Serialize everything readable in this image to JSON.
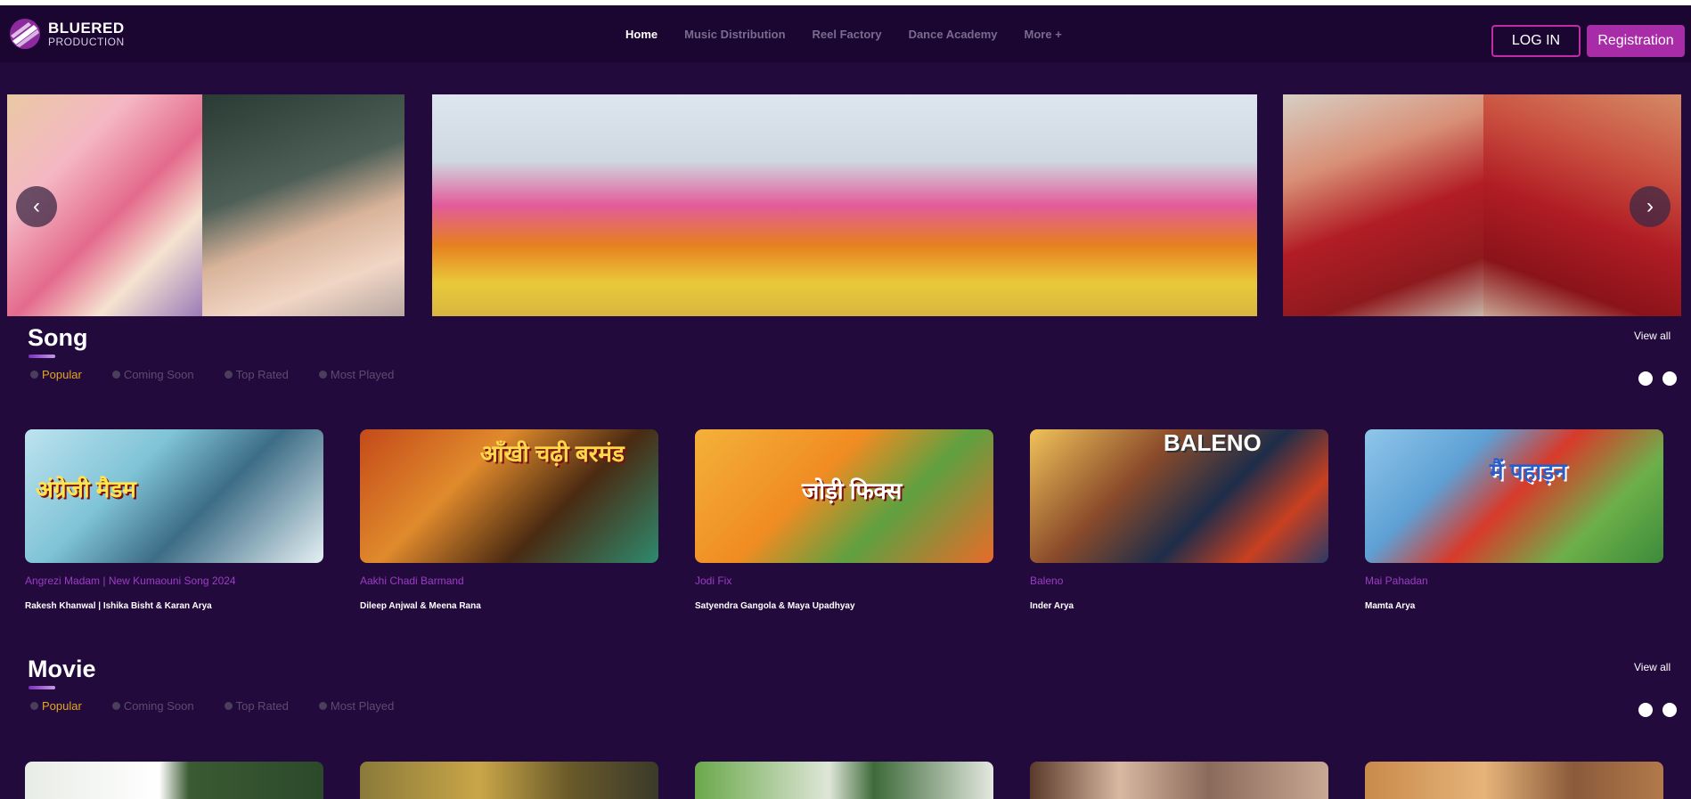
{
  "brand": {
    "line1": "BLUERED",
    "line2": "PRODUCTION",
    "accent": "#a82ba8"
  },
  "nav": {
    "items": [
      {
        "label": "Home",
        "active": true
      },
      {
        "label": "Music Distribution",
        "active": false
      },
      {
        "label": "Reel Factory",
        "active": false
      },
      {
        "label": "Dance Academy",
        "active": false
      },
      {
        "label": "More +",
        "active": false
      }
    ]
  },
  "auth": {
    "login": "LOG IN",
    "register": "Registration"
  },
  "carousel": {
    "prev_icon": "chevron-left-icon",
    "next_icon": "chevron-right-icon"
  },
  "song_section": {
    "title": "Song",
    "view_all": "View all",
    "filters": [
      "Popular",
      "Coming Soon",
      "Top Rated",
      "Most Played"
    ],
    "active_filter": "Popular",
    "cards": [
      {
        "thumb_text": "अंग्रेजी मैडम",
        "title": "Angrezi Madam | New Kumaouni Song 2024",
        "artists": "Rakesh Khanwal | Ishika Bisht & Karan Arya"
      },
      {
        "thumb_text": "आँखी चढ़ी बरमंड",
        "title": "Aakhi Chadi Barmand",
        "artists": "Dileep Anjwal & Meena Rana"
      },
      {
        "thumb_text": "जोड़ी फिक्स",
        "title": "Jodi Fix",
        "artists": "Satyendra Gangola & Maya Upadhyay"
      },
      {
        "thumb_text": "BALENO",
        "title": "Baleno",
        "artists": "Inder Arya"
      },
      {
        "thumb_text": "मैं पहाड़न",
        "title": "Mai Pahadan",
        "artists": "Mamta Arya"
      }
    ]
  },
  "movie_section": {
    "title": "Movie",
    "view_all": "View all",
    "filters": [
      "Popular",
      "Coming Soon",
      "Top Rated",
      "Most Played"
    ],
    "active_filter": "Popular"
  }
}
